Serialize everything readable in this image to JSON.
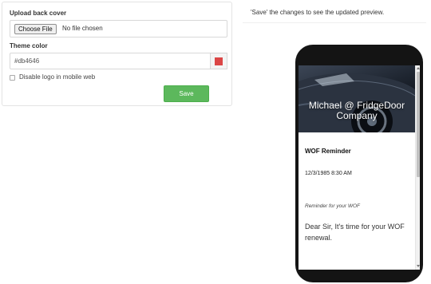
{
  "settings": {
    "upload_label": "Upload back cover",
    "choose_file_label": "Choose File",
    "file_status": "No file chosen",
    "theme_label": "Theme color",
    "theme_value": "#db4646",
    "theme_swatch_color": "#db4646",
    "disable_logo_label": "Disable logo in mobile web",
    "disable_logo_checked": false,
    "save_label": "Save"
  },
  "preview": {
    "hint": "'Save' the changes to see the updated preview.",
    "cover_title": "Michael @ FridgeDoor Company",
    "message_title": "WOF Reminder",
    "message_date": "12/3/1985 8:30 AM",
    "message_subtitle": "Reminder for your WOF",
    "message_body": "Dear Sir, It's time for your WOF renewal."
  }
}
